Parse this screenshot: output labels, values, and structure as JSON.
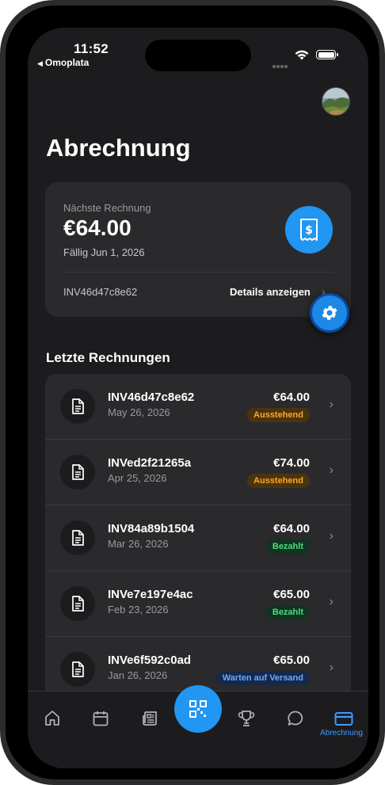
{
  "status_bar": {
    "time": "11:52",
    "back_app": "Omoplata"
  },
  "page": {
    "title": "Abrechnung"
  },
  "next_invoice": {
    "label": "Nächste Rechnung",
    "amount": "€64.00",
    "due": "Fällig Jun 1, 2026",
    "invoice_id": "INV46d47c8e62",
    "details_label": "Details anzeigen"
  },
  "recent": {
    "title": "Letzte Rechnungen",
    "items": [
      {
        "id": "INV46d47c8e62",
        "date": "May 26, 2026",
        "amount": "€64.00",
        "status": "Ausstehend"
      },
      {
        "id": "INVed2f21265a",
        "date": "Apr 25, 2026",
        "amount": "€74.00",
        "status": "Ausstehend"
      },
      {
        "id": "INV84a89b1504",
        "date": "Mar 26, 2026",
        "amount": "€64.00",
        "status": "Bezahlt"
      },
      {
        "id": "INVe7e197e4ac",
        "date": "Feb 23, 2026",
        "amount": "€65.00",
        "status": "Bezahlt"
      },
      {
        "id": "INVe6f592c0ad",
        "date": "Jan 26, 2026",
        "amount": "€65.00",
        "status": "Warten auf Versand"
      }
    ]
  },
  "tabbar": {
    "active_label": "Abrechnung",
    "icons": [
      "home-icon",
      "calendar-icon",
      "news-icon",
      "qr-scan-icon",
      "trophy-icon",
      "chat-icon",
      "card-icon"
    ]
  },
  "colors": {
    "accent": "#2196f3",
    "pending": "#ffa726",
    "paid": "#4ade80",
    "waiting": "#6ba8ff"
  }
}
